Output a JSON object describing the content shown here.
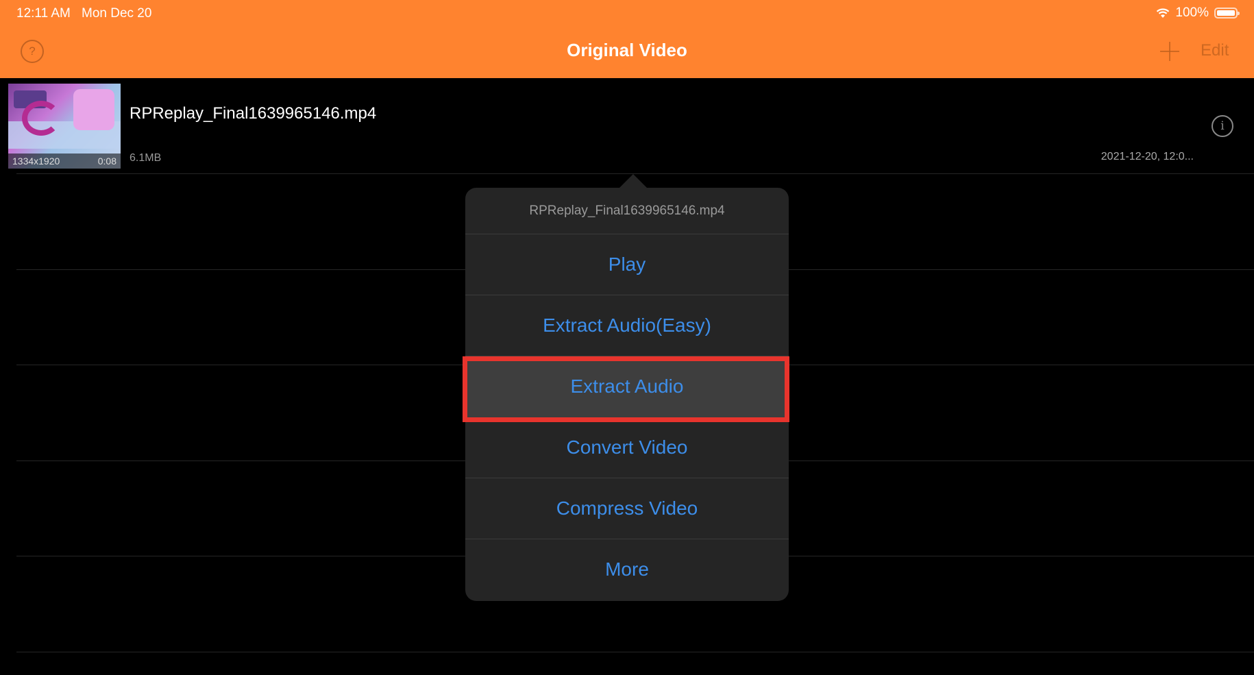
{
  "status_bar": {
    "time": "12:11 AM",
    "date": "Mon Dec 20",
    "battery": "100%"
  },
  "nav": {
    "title": "Original Video",
    "help_label": "?",
    "edit_label": "Edit"
  },
  "file": {
    "name": "RPReplay_Final1639965146.mp4",
    "resolution": "1334x1920",
    "duration": "0:08",
    "size": "6.1MB",
    "date": "2021-12-20, 12:0...",
    "info_label": "i"
  },
  "popover": {
    "title": "RPReplay_Final1639965146.mp4",
    "items": [
      "Play",
      "Extract Audio(Easy)",
      "Extract Audio",
      "Convert Video",
      "Compress Video",
      "More"
    ],
    "highlighted_item": "Extract Audio"
  },
  "colors": {
    "accent": "#ff832f",
    "action_text": "#3d8eea",
    "highlight_border": "#e8342d"
  }
}
